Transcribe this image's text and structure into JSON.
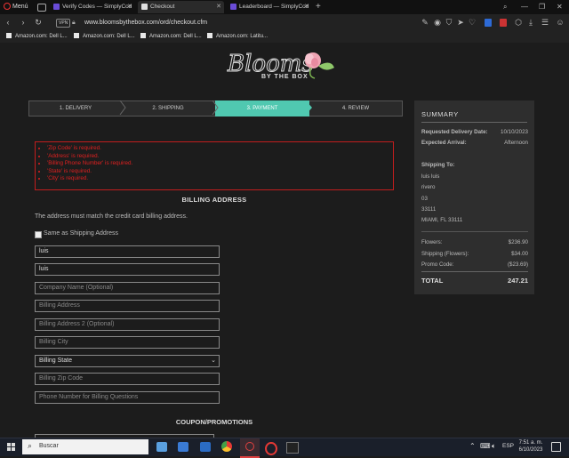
{
  "browser": {
    "menu_label": "Menú",
    "tabs": [
      {
        "label": "Verify Codes — SimplyCod",
        "color": "#6a4cd8"
      },
      {
        "label": "Checkout",
        "color": "#e0e0e0"
      },
      {
        "label": "Leaderboard — SimplyCod",
        "color": "#6a4cd8"
      }
    ],
    "url": "www.bloomsbythebox.com/ord/checkout.cfm",
    "vpn_label": "VPN",
    "bookmarks": [
      "Amazon.com: Dell L...",
      "Amazon.com: Dell L...",
      "Amazon.com: Dell L...",
      "Amazon.com: Latitu..."
    ]
  },
  "logo": {
    "text": "Blooms",
    "sub": "BY THE BOX"
  },
  "steps": [
    "1. DELIVERY",
    "2. SHIPPING",
    "3. PAYMENT",
    "4. REVIEW"
  ],
  "errors": [
    "'Zip Code' is required.",
    "'Address' is required.",
    "'Billing Phone Number' is required.",
    "'State' is required.",
    "'City' is required."
  ],
  "billing": {
    "heading": "BILLING ADDRESS",
    "note": "The address must match the credit card billing address.",
    "same_as_shipping": "Same as Shipping Address",
    "first_name": "luis",
    "last_name": "luis",
    "company_placeholder": "Company Name (Optional)",
    "address_placeholder": "Billing Address",
    "address2_placeholder": "Billing Address 2 (Optional)",
    "city_placeholder": "Billing City",
    "state_selected": "Billing State",
    "zip_placeholder": "Billing Zip Code",
    "phone_placeholder": "Phone Number for Billing Questions"
  },
  "coupon_heading": "COUPON/PROMOTIONS",
  "summary": {
    "title": "SUMMARY",
    "requested_label": "Requested Delivery Date:",
    "requested_value": "10/10/2023",
    "expected_label": "Expected Arrival:",
    "expected_value": "Afternoon",
    "shipping_to_label": "Shipping To:",
    "address_lines": [
      "luis luis",
      "rivero",
      "03",
      "33111",
      "MIAMI, FL 33111"
    ],
    "flowers_label": "Flowers:",
    "flowers_value": "$236.90",
    "shipping_label": "Shipping (Flowers):",
    "shipping_value": "$34.00",
    "promo_label": "Promo Code:",
    "promo_value": "($23.69)",
    "total_label": "TOTAL",
    "total_value": "247.21"
  },
  "taskbar": {
    "search_placeholder": "Buscar",
    "language": "ESP",
    "time": "7:51 a. m.",
    "date": "6/10/2023"
  },
  "colors": {
    "accent": "#50c8b0",
    "error": "#e02020"
  }
}
